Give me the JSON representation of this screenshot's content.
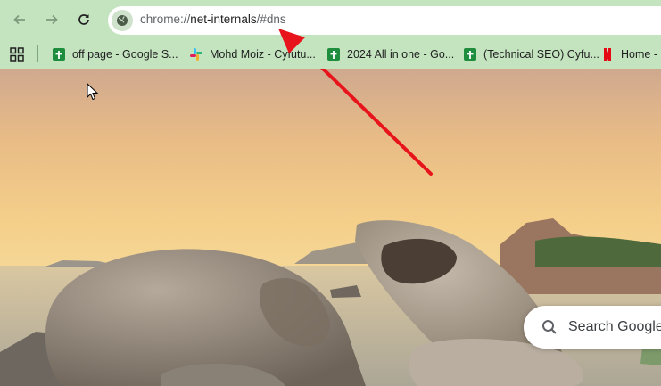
{
  "url": {
    "prefix": "chrome://",
    "host": "net-internals",
    "path": "/#dns"
  },
  "bookmarks": [
    {
      "label": "off page - Google S...",
      "icon": "google-sheets-icon"
    },
    {
      "label": "Mohd Moiz - Cyfutu...",
      "icon": "slack-icon"
    },
    {
      "label": "2024 All in one - Go...",
      "icon": "google-sheets-icon"
    },
    {
      "label": "(Technical SEO) Cyfu...",
      "icon": "google-sheets-icon"
    },
    {
      "label": "Home -",
      "icon": "netflix-icon"
    }
  ],
  "search": {
    "placeholder": "Search Google"
  },
  "colors": {
    "toolbar": "#c4e4c0",
    "arrow": "#e8141b",
    "sheets": "#1e8e3e",
    "netflix": "#e50914"
  }
}
